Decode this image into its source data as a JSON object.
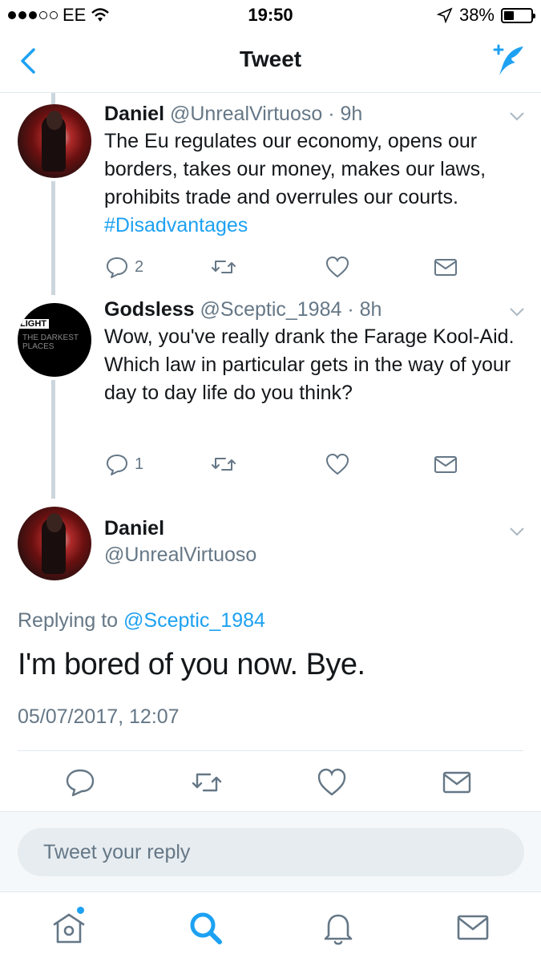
{
  "status_bar": {
    "carrier": "EE",
    "time": "19:50",
    "battery": "38%",
    "battery_level": 0.38
  },
  "nav": {
    "title": "Tweet"
  },
  "thread": [
    {
      "name": "Daniel",
      "handle": "@UnrealVirtuoso",
      "time": "· 9h",
      "text": "The Eu regulates our economy, opens our borders, takes our money, makes our laws, prohibits trade and overrules our courts.",
      "hashtag": "#Disadvantages",
      "reply_count": "2"
    },
    {
      "name": "Godsless",
      "handle": "@Sceptic_1984",
      "time": "· 8h",
      "text": "Wow, you've really drank the Farage Kool-Aid. Which law in particular gets in the way of your day to day life do you think?",
      "reply_count": "1",
      "avatar_text_top": "LIGHT",
      "avatar_text_bottom": "THE DARKEST PLACES"
    }
  ],
  "focused": {
    "name": "Daniel",
    "handle": "@UnrealVirtuoso",
    "replying_label": "Replying to",
    "replying_to": "@Sceptic_1984",
    "text": "I'm bored of you now. Bye.",
    "timestamp": "05/07/2017, 12:07"
  },
  "reply_bar": {
    "placeholder": "Tweet your reply"
  },
  "colors": {
    "accent": "#1da1f2",
    "secondary_text": "#657786",
    "divider": "#e1e8ed"
  },
  "tabs": [
    "home-icon",
    "search-icon",
    "notifications-icon",
    "messages-icon"
  ]
}
